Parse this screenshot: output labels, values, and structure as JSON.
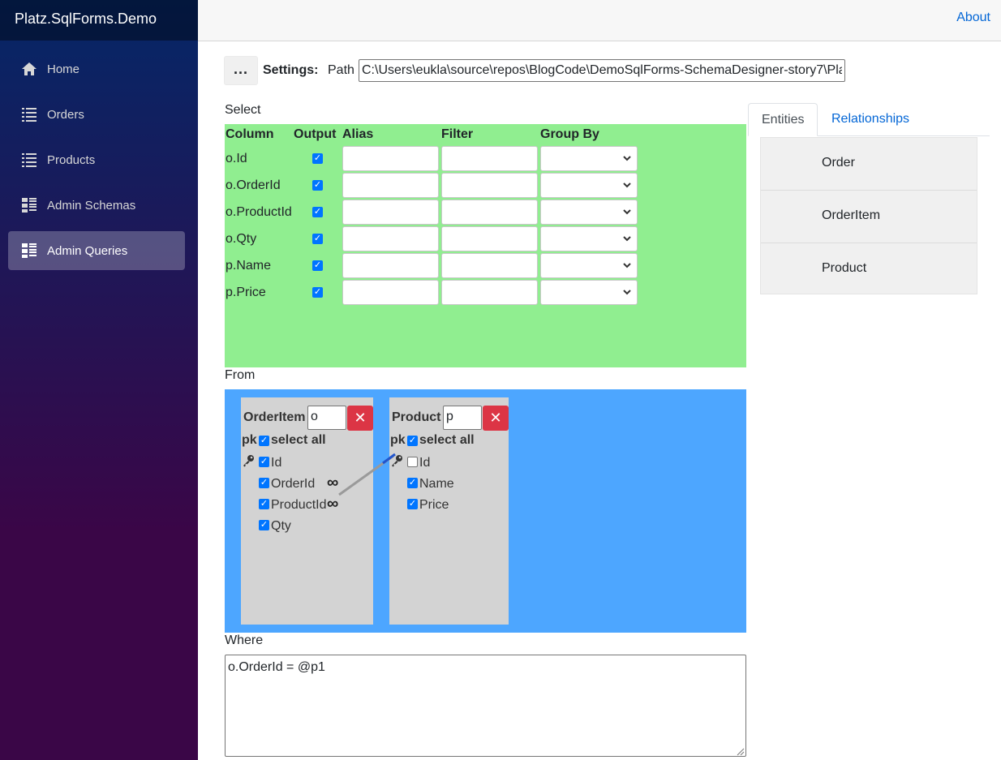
{
  "app": {
    "brand": "Platz.SqlForms.Demo"
  },
  "nav": {
    "items": [
      {
        "label": "Home",
        "icon": "home-icon"
      },
      {
        "label": "Orders",
        "icon": "list-icon"
      },
      {
        "label": "Products",
        "icon": "list-icon"
      },
      {
        "label": "Admin Schemas",
        "icon": "view-list-icon"
      },
      {
        "label": "Admin Queries",
        "icon": "view-list-icon",
        "active": true
      }
    ]
  },
  "topbar": {
    "about": "About"
  },
  "settings": {
    "menu_label": "...",
    "label": "Settings:",
    "path_label": "Path",
    "path_value": "C:\\Users\\eukla\\source\\repos\\BlogCode\\DemoSqlForms-SchemaDesigner-story7\\Pla"
  },
  "select": {
    "label": "Select",
    "headers": {
      "column": "Column",
      "output": "Output",
      "alias": "Alias",
      "filter": "Filter",
      "group_by": "Group By"
    },
    "rows": [
      {
        "column": "o.Id",
        "output": true,
        "alias": "",
        "filter": "",
        "group_by": ""
      },
      {
        "column": "o.OrderId",
        "output": true,
        "alias": "",
        "filter": "",
        "group_by": ""
      },
      {
        "column": "o.ProductId",
        "output": true,
        "alias": "",
        "filter": "",
        "group_by": ""
      },
      {
        "column": "o.Qty",
        "output": true,
        "alias": "",
        "filter": "",
        "group_by": ""
      },
      {
        "column": "p.Name",
        "output": true,
        "alias": "",
        "filter": "",
        "group_by": ""
      },
      {
        "column": "p.Price",
        "output": true,
        "alias": "",
        "filter": "",
        "group_by": ""
      }
    ]
  },
  "from": {
    "label": "From",
    "entities": [
      {
        "name": "OrderItem",
        "alias": "o",
        "close": "✕",
        "pk": "pk",
        "select_all": "select all",
        "select_all_checked": true,
        "fields": [
          {
            "name": "Id",
            "checked": true,
            "pk": true
          },
          {
            "name": "OrderId",
            "checked": true,
            "fk": true
          },
          {
            "name": "ProductId",
            "checked": true,
            "fk": true
          },
          {
            "name": "Qty",
            "checked": true
          }
        ]
      },
      {
        "name": "Product",
        "alias": "p",
        "close": "✕",
        "pk": "pk",
        "select_all": "select all",
        "select_all_checked": true,
        "fields": [
          {
            "name": "Id",
            "checked": false,
            "pk": true
          },
          {
            "name": "Name",
            "checked": true
          },
          {
            "name": "Price",
            "checked": true
          }
        ]
      }
    ]
  },
  "where": {
    "label": "Where",
    "value": "o.OrderId = @p1"
  },
  "tabs": {
    "entities": "Entities",
    "relationships": "Relationships",
    "active": "Entities"
  },
  "entity_list": [
    "Order",
    "OrderItem",
    "Product"
  ],
  "icons": {
    "check": "✓",
    "infinity": "∞",
    "key": "key-icon"
  },
  "colors": {
    "select_bg": "#90ee90",
    "from_bg": "#4da6ff",
    "close_btn": "#dc3545",
    "link": "#0366d6"
  }
}
